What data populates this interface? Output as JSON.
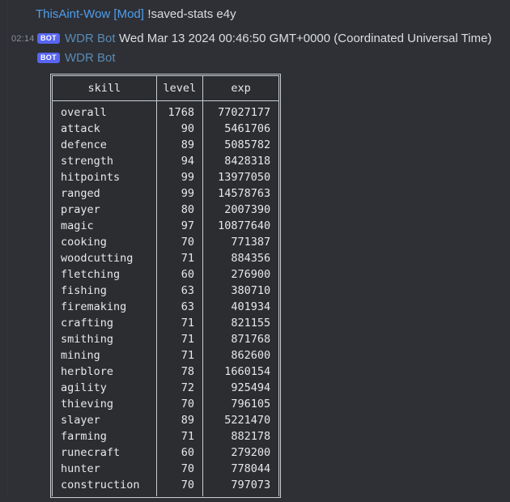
{
  "window": {
    "background_color": "#2e3035",
    "codeblock_background_color": "#2b2d31",
    "accent_color": "#5865f2",
    "link_color": "#4f9eed"
  },
  "messages": [
    {
      "timestamp": "",
      "author": "ThisAint-Wow [Mod]",
      "badge": "",
      "content": "!saved-stats e4y"
    },
    {
      "timestamp": "02:14",
      "author": "WDR Bot",
      "badge": "BOT",
      "content": "Wed Mar 13 2024 00:46:50 GMT+0000 (Coordinated Universal Time)"
    },
    {
      "timestamp": "",
      "author": "WDR Bot",
      "badge": "BOT",
      "content": ""
    }
  ],
  "stats_table": {
    "headers": [
      "skill",
      "level",
      "exp"
    ],
    "rows": [
      [
        "overall",
        "1768",
        "77027177"
      ],
      [
        "attack",
        "90",
        "5461706"
      ],
      [
        "defence",
        "89",
        "5085782"
      ],
      [
        "strength",
        "94",
        "8428318"
      ],
      [
        "hitpoints",
        "99",
        "13977050"
      ],
      [
        "ranged",
        "99",
        "14578763"
      ],
      [
        "prayer",
        "80",
        "2007390"
      ],
      [
        "magic",
        "97",
        "10877640"
      ],
      [
        "cooking",
        "70",
        "771387"
      ],
      [
        "woodcutting",
        "71",
        "884356"
      ],
      [
        "fletching",
        "60",
        "276900"
      ],
      [
        "fishing",
        "63",
        "380710"
      ],
      [
        "firemaking",
        "63",
        "401934"
      ],
      [
        "crafting",
        "71",
        "821155"
      ],
      [
        "smithing",
        "71",
        "871768"
      ],
      [
        "mining",
        "71",
        "862600"
      ],
      [
        "herblore",
        "78",
        "1660154"
      ],
      [
        "agility",
        "72",
        "925494"
      ],
      [
        "thieving",
        "70",
        "796105"
      ],
      [
        "slayer",
        "89",
        "5221470"
      ],
      [
        "farming",
        "71",
        "882178"
      ],
      [
        "runecraft",
        "60",
        "279200"
      ],
      [
        "hunter",
        "70",
        "778044"
      ],
      [
        "construction",
        "70",
        "797073"
      ]
    ]
  }
}
